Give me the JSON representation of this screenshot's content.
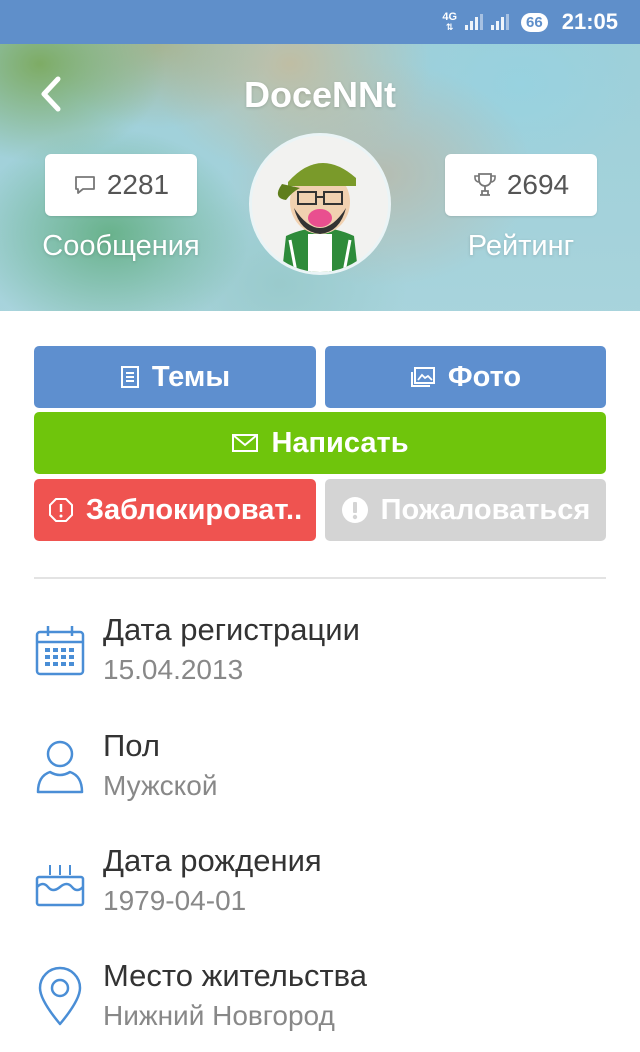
{
  "status_bar": {
    "network": "4G",
    "battery": "66",
    "time": "21:05"
  },
  "header": {
    "username": "DoceNNt",
    "messages_count": "2281",
    "messages_label": "Сообщения",
    "rating_count": "2694",
    "rating_label": "Рейтинг"
  },
  "actions": {
    "themes": "Темы",
    "photo": "Фото",
    "write": "Написать",
    "block": "Заблокироват..",
    "report": "Пожаловаться"
  },
  "info": {
    "registration": {
      "title": "Дата регистрации",
      "value": "15.04.2013"
    },
    "gender": {
      "title": "Пол",
      "value": "Мужской"
    },
    "birthday": {
      "title": "Дата рождения",
      "value": "1979-04-01"
    },
    "location": {
      "title": "Место жительства",
      "value": "Нижний Новгород"
    }
  },
  "colors": {
    "status_bar": "#5f8fca",
    "blue_button": "#5e8fcf",
    "green_button": "#6fc50c",
    "red_button": "#ef5350",
    "gray_button": "#d4d4d4",
    "icon_blue": "#4a8ed6"
  }
}
